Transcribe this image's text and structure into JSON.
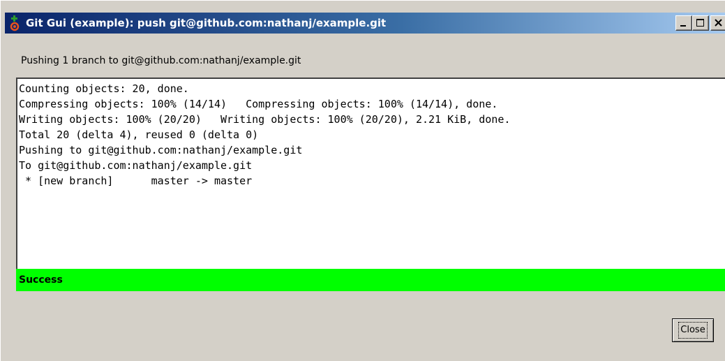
{
  "window": {
    "title": "Git Gui (example): push git@github.com:nathanj/example.git",
    "icon": "git-gui-icon",
    "controls": {
      "minimize": "minimize-icon",
      "maximize": "maximize-icon",
      "close": "close-icon"
    }
  },
  "main": {
    "heading": "Pushing 1 branch to git@github.com:nathanj/example.git",
    "console_lines": [
      "Counting objects: 20, done.",
      "Compressing objects: 100% (14/14)   Compressing objects: 100% (14/14), done.",
      "Writing objects: 100% (20/20)   Writing objects: 100% (20/20), 2.21 KiB, done.",
      "Total 20 (delta 4), reused 0 (delta 0)",
      "Pushing to git@github.com:nathanj/example.git",
      "To git@github.com:nathanj/example.git",
      " * [new branch]      master -> master"
    ],
    "status": {
      "text": "Success",
      "color": "#00ff00"
    }
  },
  "footer": {
    "close_label": "Close"
  },
  "colors": {
    "titlebar_start": "#0a246a",
    "titlebar_end": "#a6caf0",
    "window_background": "#d4d0c8"
  }
}
